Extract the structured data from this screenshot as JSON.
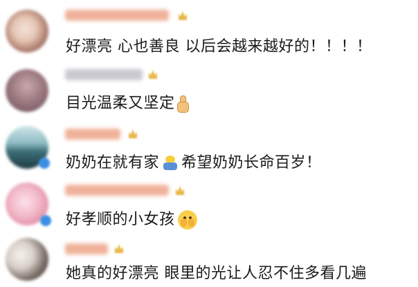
{
  "comments": [
    {
      "text": "好漂亮 心也善良 以后会越来越好的！！！！",
      "username_style": "orange"
    },
    {
      "text": "目光温柔又坚定",
      "username_style": "gray",
      "trailing_emoji": "thumbs-up-icon"
    },
    {
      "text_before": "奶奶在就有家",
      "emoji": "crying-figure-icon",
      "text_after": "希望奶奶长命百岁！",
      "username_style": "orange"
    },
    {
      "text": "好孝顺的小女孩",
      "username_style": "orange",
      "trailing_emoji": "shy-face-icon"
    },
    {
      "text": "她真的好漂亮 眼里的光让人忍不住多看几遍",
      "username_style": "orange"
    }
  ],
  "colors": {
    "username_orange": "#f0b29a",
    "username_gray": "#c9c9cf",
    "badge_blue": "#3a8ee6",
    "text": "#1a1a1a",
    "level_gold": "#e8b84a"
  }
}
